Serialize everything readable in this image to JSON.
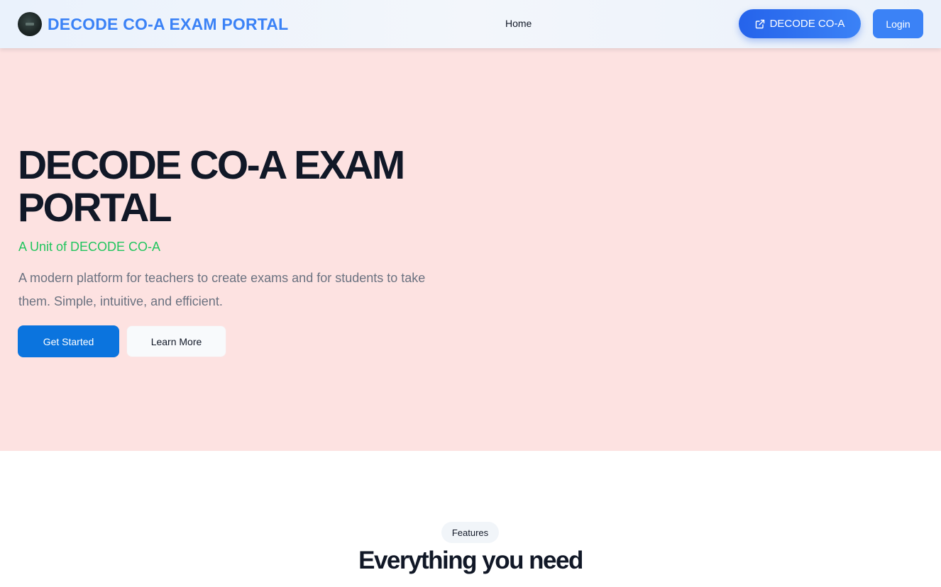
{
  "navbar": {
    "brand_title": "DECODE CO-A EXAM PORTAL",
    "brand_logo_icon": "circular-logo-icon",
    "home_link": "Home",
    "external_button_label": "DECODE CO-A",
    "external_button_icon": "external-link-icon",
    "login_button_label": "Login"
  },
  "hero": {
    "title": "DECODE CO-A EXAM PORTAL",
    "subtitle": "A Unit of DECODE CO-A",
    "description": "A modern platform for teachers to create exams and for students to take them. Simple, intuitive, and efficient.",
    "primary_button_label": "Get Started",
    "secondary_button_label": "Learn More"
  },
  "features": {
    "badge": "Features",
    "title": "Everything you need"
  },
  "colors": {
    "brand_blue": "#3b82f6",
    "hero_background": "#fde2e1",
    "subtitle_green": "#22c55e",
    "primary_button": "#0b74de"
  }
}
